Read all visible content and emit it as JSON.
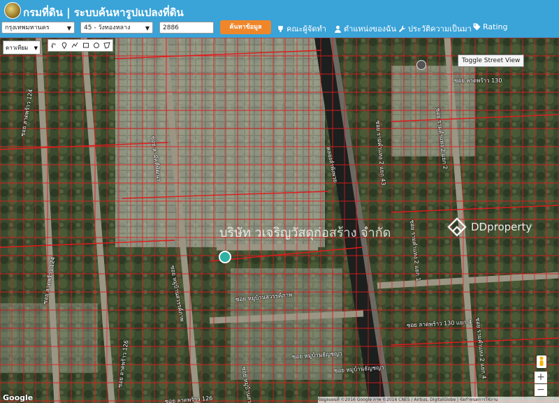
{
  "header": {
    "site_title": "กรมที่ดิน | ระบบค้นหารูปแปลงที่ดิน",
    "province": "กรุงเทพมหานคร",
    "district": "45 - วังทองหลาง",
    "parcel_number": "2886",
    "search_label": "ค้นหาข้อมูล",
    "nav": {
      "committee": "คณะผู้จัดทำ",
      "my_location": "ตำแหน่งของฉัน",
      "history": "ประวัติความเป็นมา",
      "rating": "Rating"
    }
  },
  "map": {
    "map_type": "ดาวเทียม",
    "toggle_street_view": "Toggle Street View",
    "google": "Google",
    "attribution": "ข้อมูลแผนที่ ©2016 Google ภาพ ©2016 CNES / Airbus, DigitalGlobe | ข้อกำหนดการใช้งาน",
    "zoom_in": "+",
    "zoom_out": "−",
    "roads": {
      "r1": "ซอย ลาดพร้าว 124",
      "r2": "ซอย ลาดพร้าว 124",
      "r3": "ซอย สามัคคีพัฒนา",
      "r4": "ซอย ลาดพร้าว 126",
      "r5": "ซอย ลาดพร้าว 126",
      "r6": "ซอย หมู่บ้านสวรรค์ภาพ",
      "r7": "ซอย หมู่บ้านสวรรค์ภาพ",
      "r8": "ซอย หมู่บ้านธัญชญา",
      "r9": "ซอย หมู่บ้านธัญชญา",
      "r10": "ซอย หมู่บ้านสวนรักษ์",
      "r11": "คลองลำพังพวย",
      "r12": "ซอย รามคำแหง 2 แยก 43",
      "r13": "ซอย รามคำแหง 2 แยก 2",
      "r14": "ซอย รามคำแหง 2 แยก 4",
      "r15": "ซอย ลาดพร้าว 130 แยก 4",
      "r16": "ซอย ลาดพร้าว 130",
      "r17": "ซอย รามคำแหง 2 แยก 1"
    },
    "watermark_company": "บริษัท วเจริญวัสดุก่อสร้าง จำกัด",
    "watermark_brand": "DDproperty"
  }
}
